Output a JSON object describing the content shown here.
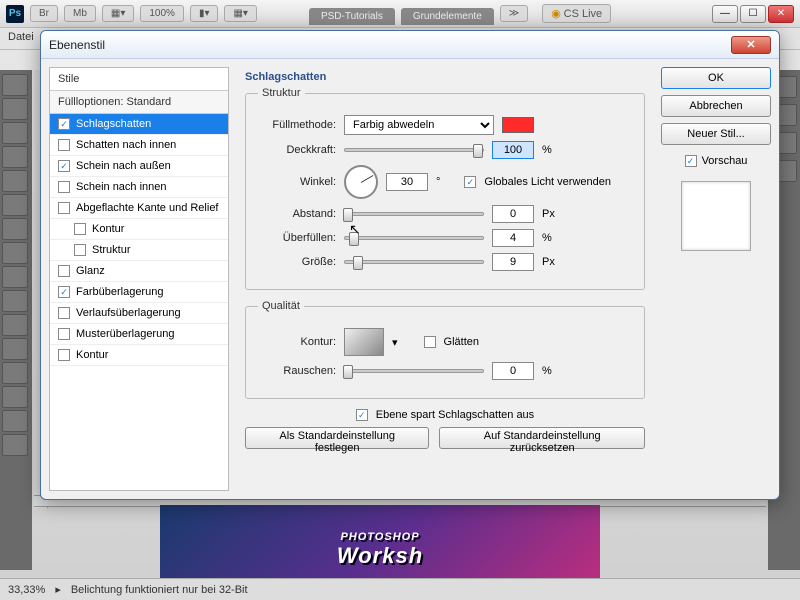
{
  "ps": {
    "logo": "Ps",
    "toolbar": {
      "br": "Br",
      "mb": "Mb",
      "zoom": "100%",
      "tabs": [
        "PSD-Tutorials",
        "Grundelemente"
      ],
      "more": "≫",
      "cslive": "CS Live"
    },
    "menu_first": "Datei",
    "status": {
      "zoom": "33,33%",
      "msg": "Belichtung funktioniert nur bei 32-Bit"
    },
    "canvas": {
      "line1": "PHOTOSHOP",
      "line2": "Worksh"
    }
  },
  "dlg": {
    "title": "Ebenenstil",
    "styles_head": "Stile",
    "fill_opts": "Füllloptionen: Standard",
    "items": [
      {
        "label": "Schlagschatten",
        "checked": true,
        "selected": true
      },
      {
        "label": "Schatten nach innen",
        "checked": false
      },
      {
        "label": "Schein nach außen",
        "checked": true
      },
      {
        "label": "Schein nach innen",
        "checked": false
      },
      {
        "label": "Abgeflachte Kante und Relief",
        "checked": false
      },
      {
        "label": "Kontur",
        "checked": false,
        "indent": true
      },
      {
        "label": "Struktur",
        "checked": false,
        "indent": true
      },
      {
        "label": "Glanz",
        "checked": false
      },
      {
        "label": "Farbüberlagerung",
        "checked": true
      },
      {
        "label": "Verlaufsüberlagerung",
        "checked": false
      },
      {
        "label": "Musterüberlagerung",
        "checked": false
      },
      {
        "label": "Kontur",
        "checked": false
      }
    ],
    "panel_title": "Schlagschatten",
    "struct": {
      "legend": "Struktur",
      "blend_lbl": "Füllmethode:",
      "blend_val": "Farbig abwedeln",
      "swatch": "#ff2b2b",
      "opacity_lbl": "Deckkraft:",
      "opacity_val": "100",
      "opacity_unit": "%",
      "angle_lbl": "Winkel:",
      "angle_val": "30",
      "angle_unit": "°",
      "global_lbl": "Globales Licht verwenden",
      "global_chk": true,
      "distance_lbl": "Abstand:",
      "distance_val": "0",
      "distance_unit": "Px",
      "spread_lbl": "Überfüllen:",
      "spread_val": "4",
      "spread_unit": "%",
      "size_lbl": "Größe:",
      "size_val": "9",
      "size_unit": "Px"
    },
    "qual": {
      "legend": "Qualität",
      "contour_lbl": "Kontur:",
      "aa_lbl": "Glätten",
      "aa_chk": false,
      "noise_lbl": "Rauschen:",
      "noise_val": "0",
      "noise_unit": "%"
    },
    "knockout_lbl": "Ebene spart Schlagschatten aus",
    "knockout_chk": true,
    "make_default": "Als Standardeinstellung festlegen",
    "reset_default": "Auf Standardeinstellung zurücksetzen",
    "ok": "OK",
    "cancel": "Abbrechen",
    "newstyle": "Neuer Stil...",
    "preview_lbl": "Vorschau",
    "preview_chk": true
  }
}
